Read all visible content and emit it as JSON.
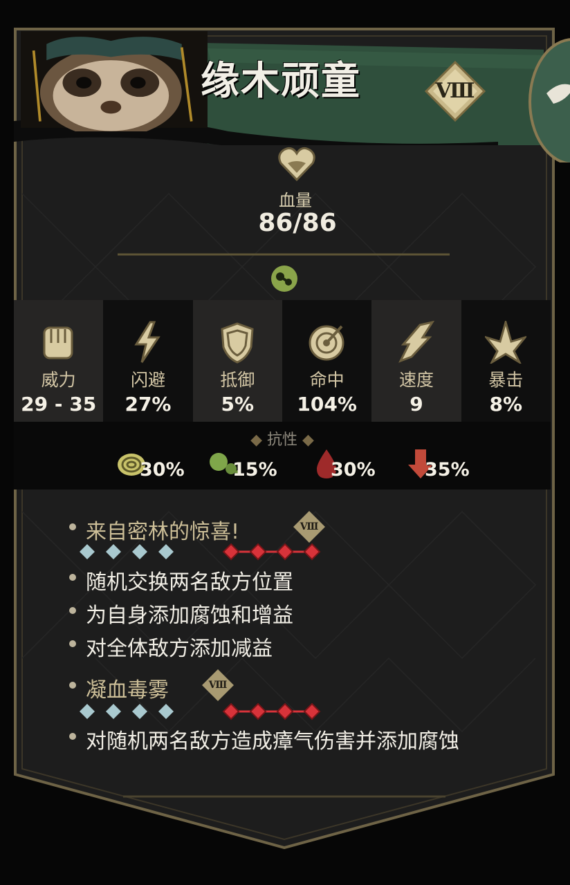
{
  "character": {
    "name": "缘木顽童",
    "rank": "Ⅷ"
  },
  "health": {
    "label": "血量",
    "value": "86/86"
  },
  "stats": [
    {
      "name": "威力",
      "value": "29 - 35",
      "icon": "fist-icon"
    },
    {
      "name": "闪避",
      "value": "27%",
      "icon": "lightning-icon"
    },
    {
      "name": "抵御",
      "value": "5%",
      "icon": "shield-icon"
    },
    {
      "name": "命中",
      "value": "104%",
      "icon": "target-icon"
    },
    {
      "name": "速度",
      "value": "9",
      "icon": "wing-speed-icon"
    },
    {
      "name": "暴击",
      "value": "8%",
      "icon": "crit-burst-icon"
    }
  ],
  "resistances": {
    "title": "抗性",
    "items": [
      {
        "icon": "stun-swirl-icon",
        "value": "30%",
        "color": "#c9c36a"
      },
      {
        "icon": "miasma-icon",
        "value": "15%",
        "color": "#7fa64a"
      },
      {
        "icon": "bleed-icon",
        "value": "30%",
        "color": "#9e2a2a"
      },
      {
        "icon": "debuff-arrow-icon",
        "value": "35%",
        "color": "#c24a3a"
      }
    ]
  },
  "skills": [
    {
      "name": "来自密林的惊喜!",
      "level": "Ⅷ",
      "effects": [
        "随机交换两名敌方位置",
        "为自身添加腐蚀和增益",
        "对全体敌方添加减益"
      ]
    },
    {
      "name": "凝血毒雾",
      "level": "Ⅷ",
      "effects": [
        "对随机两名敌方造成瘴气伤害并添加腐蚀"
      ]
    }
  ],
  "colors": {
    "frame_gold": "#8a7a52",
    "banner_green": "#2f4f3c",
    "position_ally": "#a9c9cf",
    "position_enemy": "#d8333a"
  }
}
